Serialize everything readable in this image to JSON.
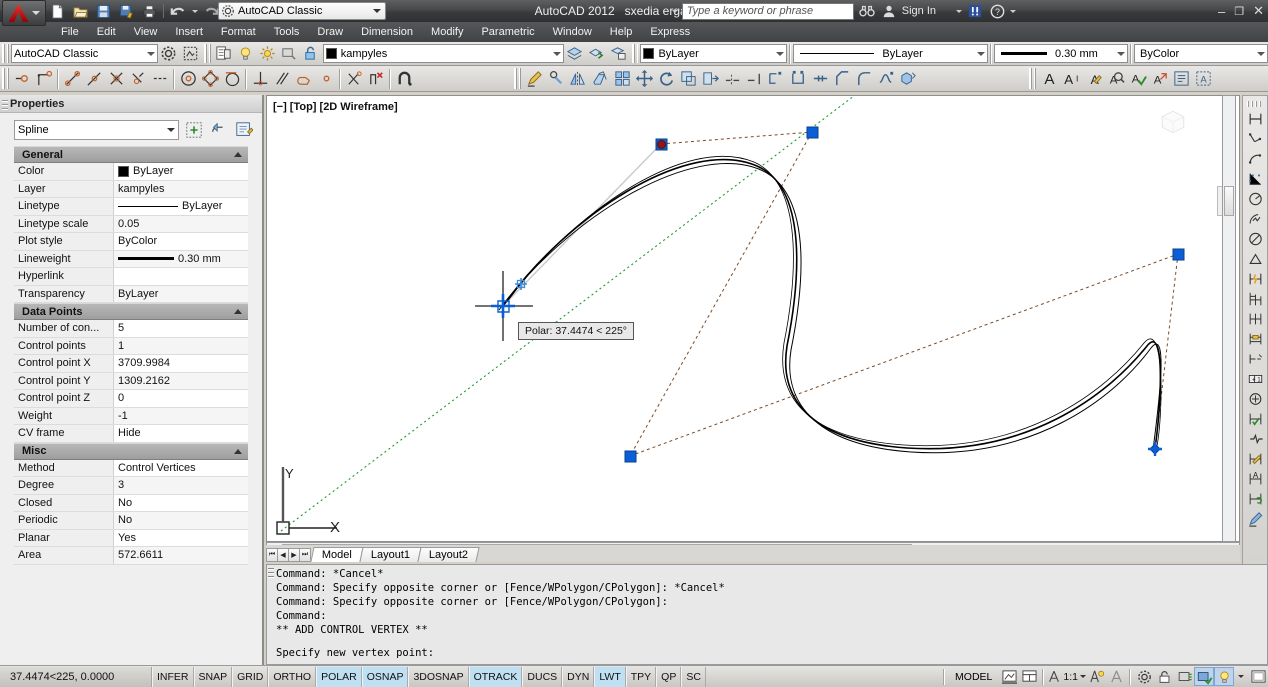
{
  "window": {
    "app_title": "AutoCAD 2012",
    "document_title": "sxedia ergasias.dwg",
    "workspace": "AutoCAD Classic",
    "search_placeholder": "Type a keyword or phrase",
    "sign_in": "Sign In",
    "minimize": "–",
    "restore": "❐",
    "close": "✕"
  },
  "quick_access": {
    "items": [
      {
        "name": "new-file-icon",
        "label": "New"
      },
      {
        "name": "open-file-icon",
        "label": "Open"
      },
      {
        "name": "save-icon",
        "label": "Save"
      },
      {
        "name": "save-as-icon",
        "label": "Save As"
      },
      {
        "name": "plot-icon",
        "label": "Plot"
      },
      {
        "name": "undo-icon",
        "label": "Undo"
      },
      {
        "name": "redo-icon",
        "label": "Redo"
      }
    ]
  },
  "menu": {
    "items": [
      "File",
      "Edit",
      "View",
      "Insert",
      "Format",
      "Tools",
      "Draw",
      "Dimension",
      "Modify",
      "Parametric",
      "Window",
      "Help",
      "Express"
    ]
  },
  "toolbar_row2": {
    "workspace_value": "AutoCAD Classic",
    "layer_value": "kampyles",
    "color_value": "ByLayer",
    "linetype_value": "ByLayer",
    "lineweight_value": "0.30 mm",
    "plotstyle_value": "ByColor"
  },
  "properties": {
    "title": "Properties",
    "object_type": "Spline",
    "sections": [
      {
        "name": "General",
        "rows": [
          {
            "key": "Color",
            "value": "ByLayer",
            "swatch": "#000000"
          },
          {
            "key": "Layer",
            "value": "kampyles"
          },
          {
            "key": "Linetype",
            "value": "ByLayer",
            "line": "solid"
          },
          {
            "key": "Linetype scale",
            "value": "0.05"
          },
          {
            "key": "Plot style",
            "value": "ByColor"
          },
          {
            "key": "Lineweight",
            "value": "0.30 mm",
            "line": "thick"
          },
          {
            "key": "Hyperlink",
            "value": ""
          },
          {
            "key": "Transparency",
            "value": "ByLayer"
          }
        ]
      },
      {
        "name": "Data Points",
        "rows": [
          {
            "key": "Number of con...",
            "value": "5"
          },
          {
            "key": "Control points",
            "value": "1"
          },
          {
            "key": "Control point X",
            "value": "3709.9984"
          },
          {
            "key": "Control point Y",
            "value": "1309.2162"
          },
          {
            "key": "Control point Z",
            "value": "0"
          },
          {
            "key": "Weight",
            "value": "-1"
          },
          {
            "key": "CV frame",
            "value": "Hide"
          }
        ]
      },
      {
        "name": "Misc",
        "rows": [
          {
            "key": "Method",
            "value": "Control Vertices"
          },
          {
            "key": "Degree",
            "value": "3"
          },
          {
            "key": "Closed",
            "value": "No"
          },
          {
            "key": "Periodic",
            "value": "No"
          },
          {
            "key": "Planar",
            "value": "Yes"
          },
          {
            "key": "Area",
            "value": "572.6611"
          }
        ]
      }
    ]
  },
  "canvas": {
    "viewport_label": "[−] [Top] [2D Wireframe]",
    "polar_tooltip": "Polar: 37.4474 < 225°",
    "ucs_x_label": "X",
    "ucs_y_label": "Y"
  },
  "layout_tabs": {
    "tabs": [
      "Model",
      "Layout1",
      "Layout2"
    ],
    "active": "Model",
    "nav": [
      "⏮",
      "◀",
      "▶",
      "⏭"
    ]
  },
  "command_line": {
    "history": [
      "Command: *Cancel*",
      "Command: Specify opposite corner or [Fence/WPolygon/CPolygon]: *Cancel*",
      "Command: Specify opposite corner or [Fence/WPolygon/CPolygon]:",
      "Command:",
      "** ADD CONTROL VERTEX **"
    ],
    "prompt": "Specify new vertex point:"
  },
  "status_bar": {
    "coordinates": "37.4474<225, 0.0000",
    "toggles": [
      {
        "label": "INFER",
        "active": false
      },
      {
        "label": "SNAP",
        "active": false
      },
      {
        "label": "GRID",
        "active": false
      },
      {
        "label": "ORTHO",
        "active": false
      },
      {
        "label": "POLAR",
        "active": true
      },
      {
        "label": "OSNAP",
        "active": true
      },
      {
        "label": "3DOSNAP",
        "active": false
      },
      {
        "label": "OTRACK",
        "active": true
      },
      {
        "label": "DUCS",
        "active": false
      },
      {
        "label": "DYN",
        "active": false
      },
      {
        "label": "LWT",
        "active": true
      },
      {
        "label": "TPY",
        "active": false
      },
      {
        "label": "QP",
        "active": false
      },
      {
        "label": "SC",
        "active": false
      }
    ],
    "model_button": "MODEL",
    "annotation_scale": "1:1",
    "right_icons": [
      "model-space-icon",
      "layout-space-icon",
      "annotation-scale-icon",
      "annotation-visibility-icon",
      "autoscale-icon",
      "workspace-gear-icon",
      "toolbar-lock-icon",
      "hardware-accel-icon",
      "isolate-objects-icon",
      "cleanscreen-icon"
    ]
  },
  "colors": {
    "accent_blue": "#0a5bd3",
    "grip_blue": "#0b5fd6",
    "grip_red": "#8e1616",
    "tracking_green": "#1c9b2a",
    "tracking_brown": "#7a4b2a",
    "status_on": "#bfe0f2"
  }
}
